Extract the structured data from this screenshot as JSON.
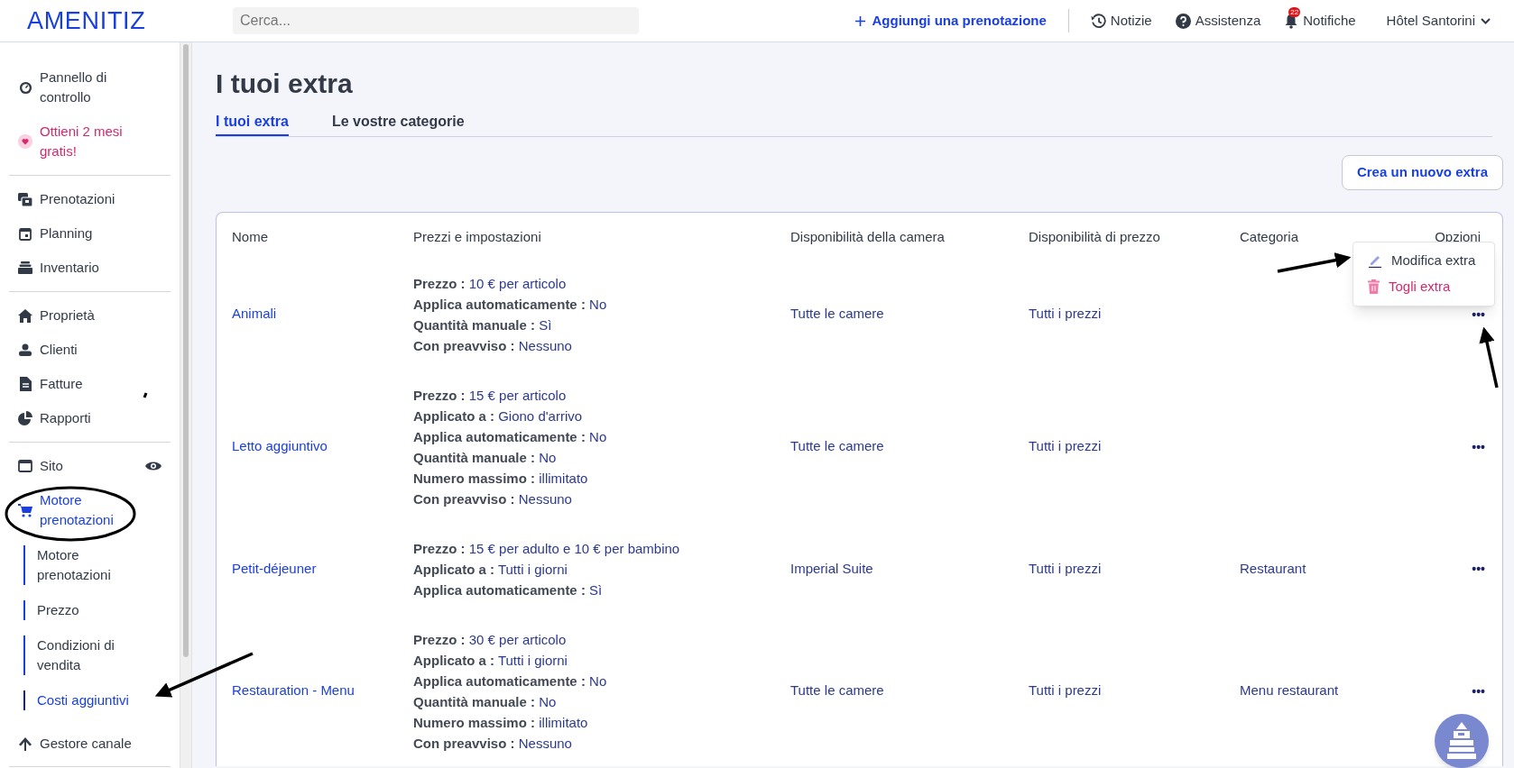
{
  "header": {
    "logo": "AMENITIZ",
    "search": {
      "placeholder": "Cerca..."
    },
    "add_button": "Aggiungi una prenotazione",
    "links": [
      {
        "kind": "news",
        "label": "Notizie"
      },
      {
        "kind": "help",
        "label": "Assistenza"
      },
      {
        "kind": "notifications",
        "label": "Notifiche",
        "badge": "22"
      }
    ],
    "hotel": "Hôtel Santorini"
  },
  "sidebar": {
    "groups": [
      {
        "items": [
          {
            "kind": "dashboard",
            "label": "Pannello di controllo",
            "selected": false
          },
          {
            "kind": "promo",
            "label": "Ottieni 2 mesi gratis!",
            "selected": false
          }
        ]
      },
      {
        "items": [
          {
            "kind": "bookings",
            "label": "Prenotazioni",
            "selected": false
          },
          {
            "kind": "calendar",
            "label": "Planning",
            "selected": false
          },
          {
            "kind": "inventory",
            "label": "Inventario",
            "selected": false
          }
        ]
      },
      {
        "items": [
          {
            "kind": "home",
            "label": "Proprietà",
            "selected": false
          },
          {
            "kind": "clients",
            "label": "Clienti",
            "selected": false
          },
          {
            "kind": "invoice",
            "label": "Fatture",
            "selected": false
          },
          {
            "kind": "reports",
            "label": "Rapporti",
            "selected": false
          }
        ]
      },
      {
        "items": [
          {
            "kind": "site",
            "label": "Sito",
            "selected": false
          },
          {
            "kind": "cart",
            "label": "Motore prenotazioni",
            "selected": true,
            "children": [
              {
                "label": "Motore prenotazioni",
                "selected": false
              },
              {
                "label": "Prezzo",
                "selected": false
              },
              {
                "label": "Condizioni di vendita",
                "selected": false
              },
              {
                "label": "Costi aggiuntivi",
                "selected": true
              }
            ]
          },
          {
            "kind": "channel",
            "label": "Gestore canale",
            "selected": false
          }
        ]
      }
    ]
  },
  "page": {
    "title": "I tuoi extra",
    "tabs": [
      {
        "label": "I tuoi extra",
        "selected": true
      },
      {
        "label": "Le vostre categorie",
        "selected": false
      }
    ],
    "create_button": "Crea un nuovo extra"
  },
  "table": {
    "columns": [
      "Nome",
      "Prezzi e impostazioni",
      "Disponibilità della camera",
      "Disponibilità di prezzo",
      "Categoria",
      "Opzioni"
    ],
    "rows": [
      {
        "name": "Animali",
        "settings": [
          {
            "label": "Prezzo :",
            "value": "10 € per articolo"
          },
          {
            "label": "Applica automaticamente :",
            "value": "No"
          },
          {
            "label": "Quantità manuale :",
            "value": "Sì"
          },
          {
            "label": "Con preavviso :",
            "value": "Nessuno"
          }
        ],
        "rooms": "Tutte le camere",
        "prices": "Tutti i prezzi",
        "options": "•••",
        "menu": [
          {
            "kind": "edit",
            "label": "Modifica extra"
          },
          {
            "kind": "delete",
            "label": "Togli extra"
          }
        ]
      },
      {
        "name": "Letto aggiuntivo",
        "settings": [
          {
            "label": "Prezzo :",
            "value": "15 € per articolo"
          },
          {
            "label": "Applicato a :",
            "value": "Giono d'arrivo"
          },
          {
            "label": "Applica automaticamente :",
            "value": "No"
          },
          {
            "label": "Quantità manuale :",
            "value": "No"
          },
          {
            "label": "Numero massimo :",
            "value": "illimitato"
          },
          {
            "label": "Con preavviso :",
            "value": "Nessuno"
          }
        ],
        "rooms": "Tutte le camere",
        "prices": "Tutti i prezzi",
        "options": "•••"
      },
      {
        "name": "Petit-déjeuner",
        "settings": [
          {
            "label": "Prezzo :",
            "value": "15 € per adulto e 10 € per bambino"
          },
          {
            "label": "Applicato a :",
            "value": "Tutti i giorni"
          },
          {
            "label": "Applica automaticamente :",
            "value": "Sì"
          }
        ],
        "rooms": "Imperial Suite",
        "prices": "Tutti i prezzi",
        "category": "Restaurant",
        "options": "•••"
      },
      {
        "name": "Restauration - Menu",
        "settings": [
          {
            "label": "Prezzo :",
            "value": "30 € per articolo"
          },
          {
            "label": "Applicato a :",
            "value": "Tutti i giorni"
          },
          {
            "label": "Applica automaticamente :",
            "value": "No"
          },
          {
            "label": "Quantità manuale :",
            "value": "No"
          },
          {
            "label": "Numero massimo :",
            "value": "illimitato"
          },
          {
            "label": "Con preavviso :",
            "value": "Nessuno"
          }
        ],
        "rooms": "Tutte le camere",
        "prices": "Tutti i prezzi",
        "category": "Menu restaurant",
        "options": "•••"
      }
    ]
  }
}
